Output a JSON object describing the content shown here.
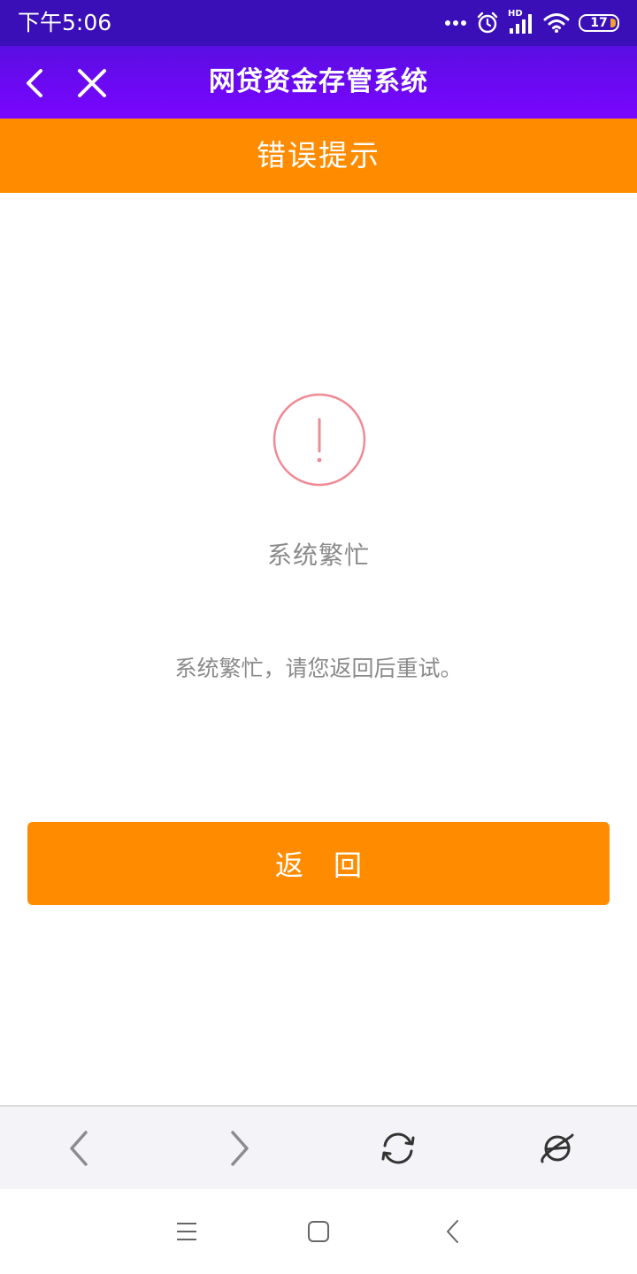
{
  "status_bar": {
    "time": "下午5:06",
    "network_label": "HD",
    "battery_level": "17"
  },
  "header": {
    "title": "网贷资金存管系统",
    "back_icon": "chevron-left-icon",
    "close_icon": "close-icon"
  },
  "page_header": {
    "title": "错误提示"
  },
  "error": {
    "icon": "exclamation-circle-icon",
    "title": "系统繁忙",
    "message": "系统繁忙，请您返回后重试。"
  },
  "actions": {
    "return_label": "返回"
  },
  "browser_toolbar": {
    "icons": [
      "back-icon",
      "forward-icon",
      "refresh-icon",
      "browser-planet-icon"
    ]
  },
  "system_nav": {
    "icons": [
      "menu-icon",
      "home-icon",
      "back-icon"
    ]
  },
  "colors": {
    "status_bar": "#3a0fb8",
    "title_bar": "#7a05ff",
    "accent_orange": "#ff8c00",
    "alert_pink": "#f08a94",
    "muted_text": "#8a8a8a"
  }
}
